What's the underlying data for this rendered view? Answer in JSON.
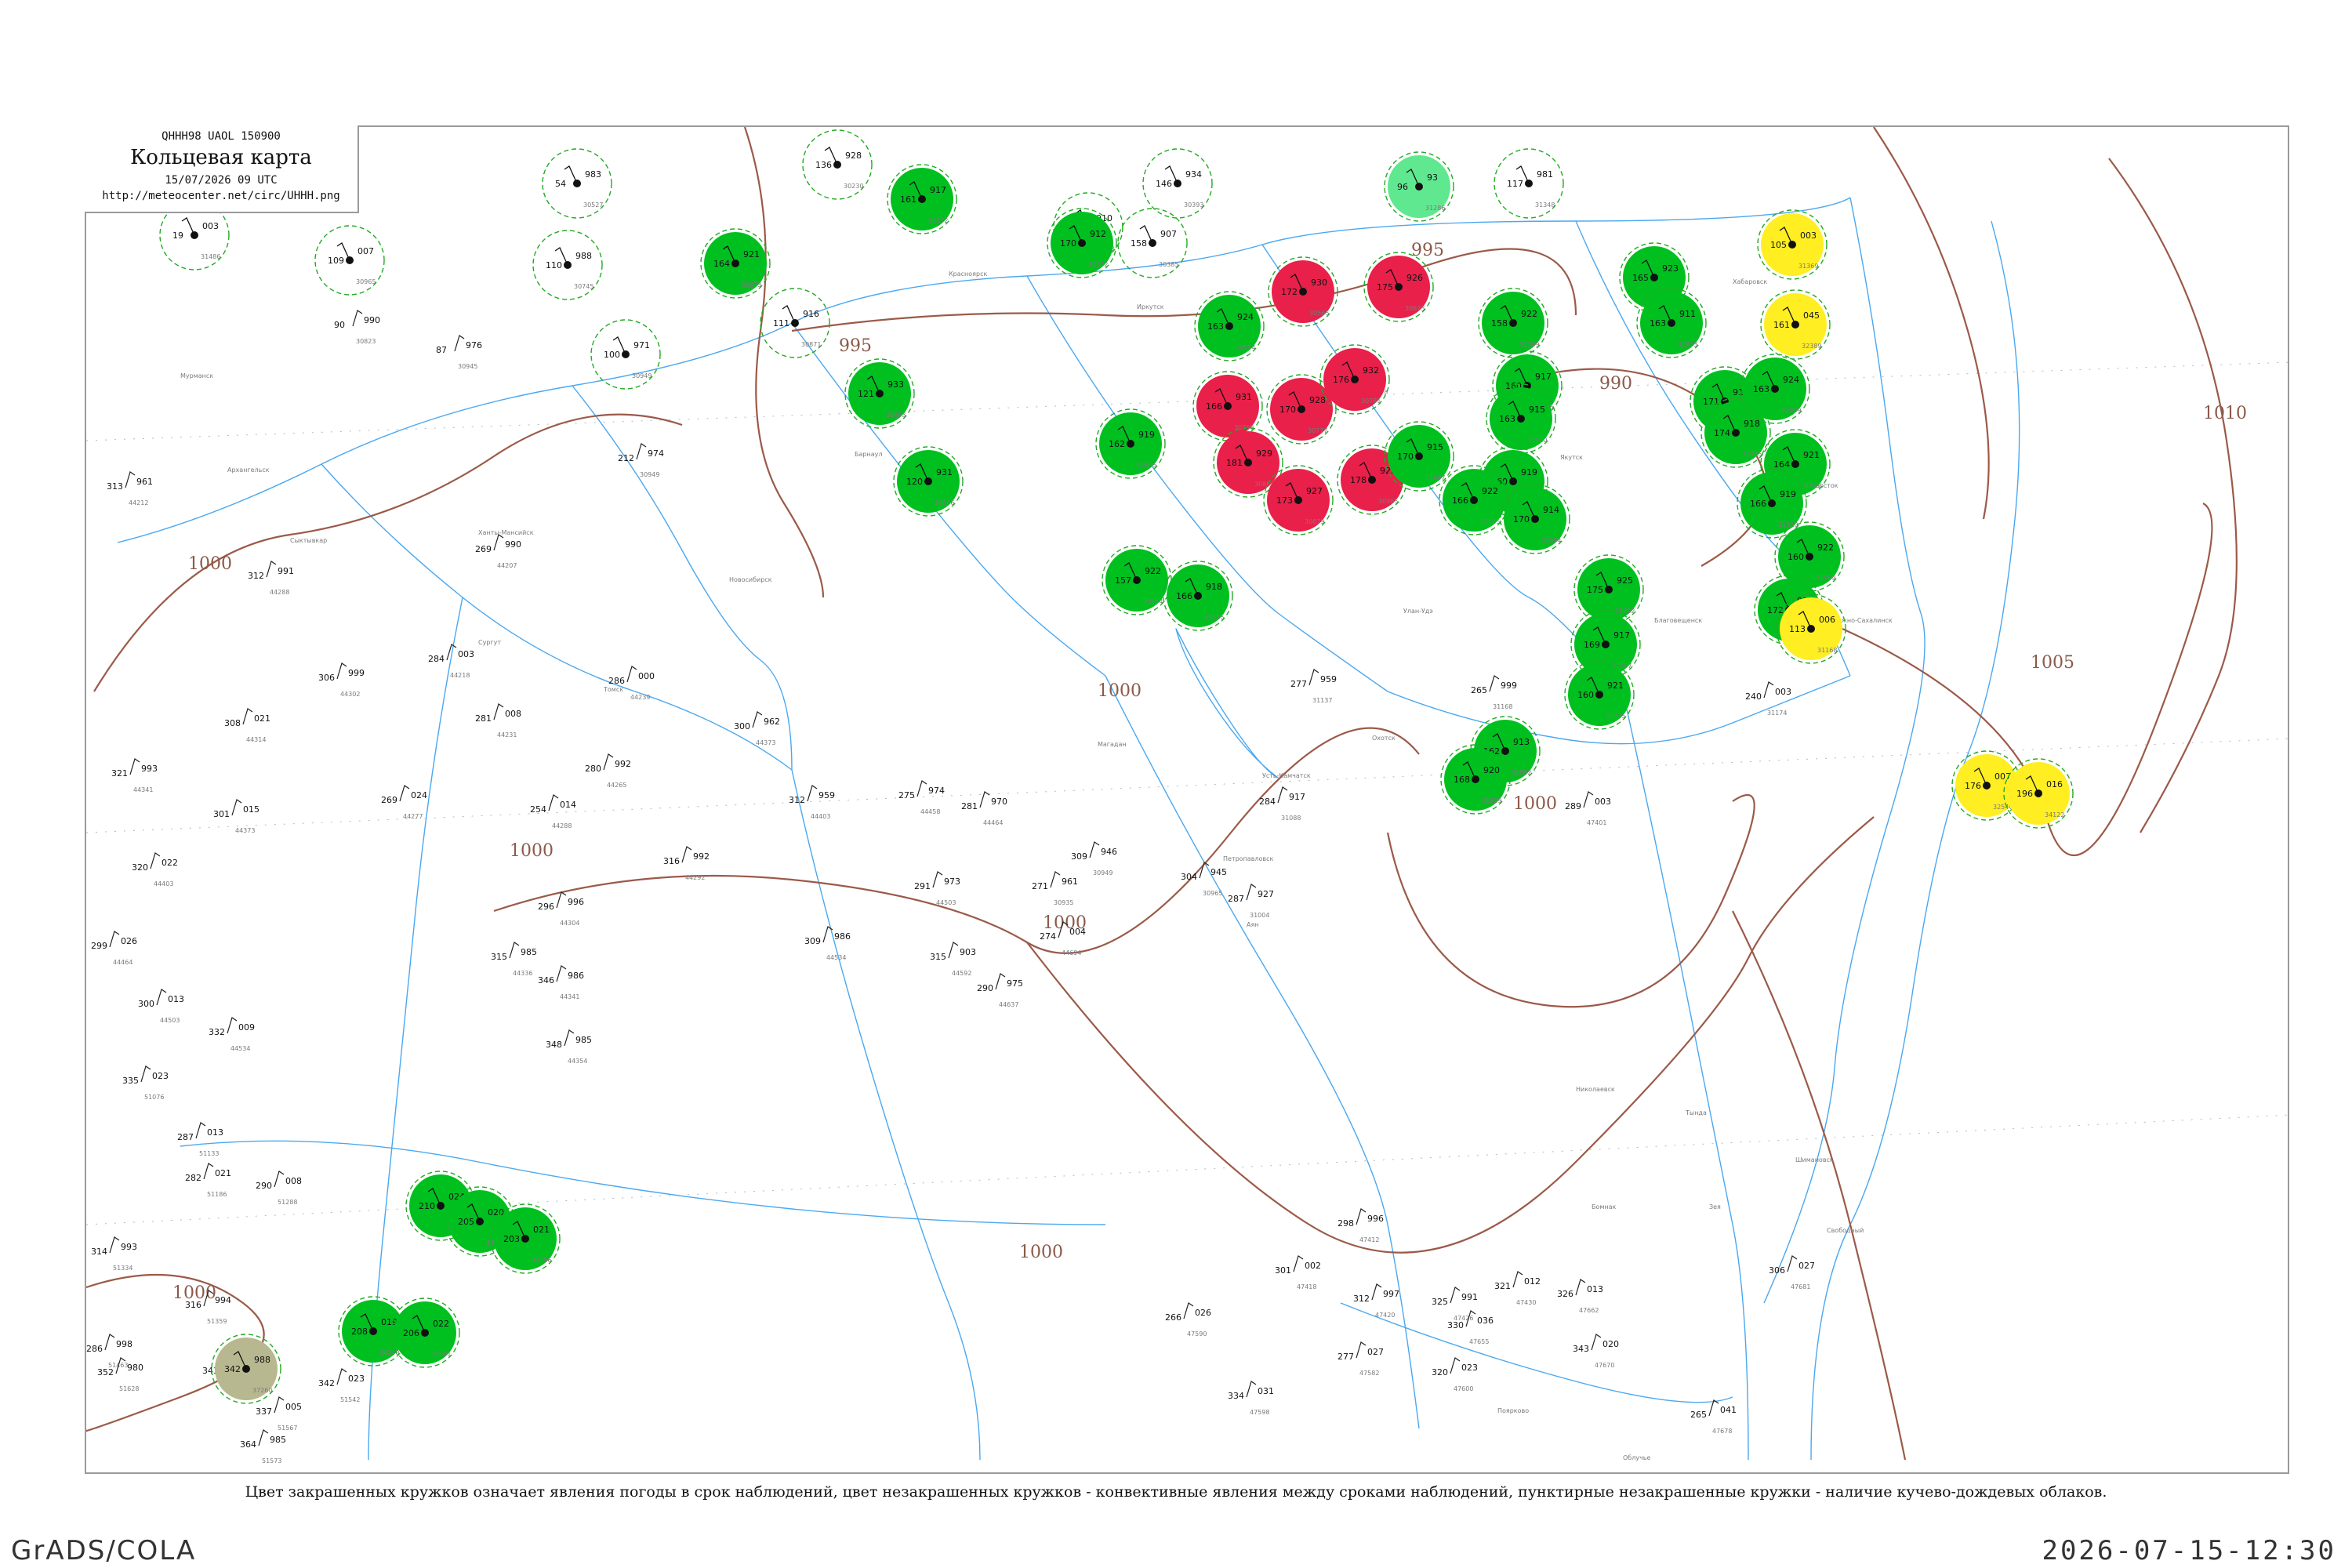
{
  "title_box": {
    "code": "QHHH98  UAOL  150900",
    "title": "Кольцевая карта",
    "date": "15/07/2026 09 UTC",
    "url": "http://meteocenter.net/circ/UHHH.png"
  },
  "caption": "Цвет закрашенных кружков означает явления погоды в срок наблюдений, цвет незакрашенных кружков - конвективные явления между сроками наблюдений, пунктирные незакрашенные кружки - наличие кучево-дождевых облаков.",
  "footer": {
    "left": "GrADS/COLA",
    "right": "2026-07-15-12:30"
  },
  "colors": {
    "rain": "#00c020",
    "thunder": "#e8204a",
    "showers": "#ffee22",
    "haze": "#b8b890",
    "fog": "#60e890",
    "isobar": "#9b5a48",
    "water": "#4aa8f0",
    "dashed_ring": "#22aa22"
  },
  "isobar_labels": [
    {
      "text": "995"
    },
    {
      "text": "995"
    },
    {
      "text": "990"
    },
    {
      "text": "1000"
    },
    {
      "text": "1000"
    },
    {
      "text": "1000"
    },
    {
      "text": "1000"
    },
    {
      "text": "1000"
    },
    {
      "text": "1000"
    },
    {
      "text": "1000"
    },
    {
      "text": "1005"
    },
    {
      "text": "1010"
    },
    {
      "text": "1000"
    }
  ],
  "stations": [
    {
      "ring": "dashed",
      "fill": "none",
      "p": "003",
      "t": "19",
      "id": "31486"
    },
    {
      "ring": "dashed",
      "fill": "none",
      "p": "007",
      "t": "109",
      "id": "30965"
    },
    {
      "ring": "dashed",
      "fill": "none",
      "p": "983",
      "t": "54",
      "id": "30527"
    },
    {
      "ring": "dashed",
      "fill": "none",
      "p": "988",
      "t": "110",
      "id": "30745"
    },
    {
      "ring": "solid",
      "fill": "rain",
      "p": "921",
      "t": "164",
      "id": "30673"
    },
    {
      "ring": "dashed",
      "fill": "none",
      "p": "971",
      "t": "100",
      "id": "30949"
    },
    {
      "ring": "dashed",
      "fill": "none",
      "p": "916",
      "t": "111",
      "id": "30871"
    },
    {
      "ring": "solid",
      "fill": "rain",
      "p": "933",
      "t": "121",
      "id": "30853"
    },
    {
      "ring": "solid",
      "fill": "rain",
      "p": "931",
      "t": "120",
      "id": "30846"
    },
    {
      "ring": "dashed",
      "fill": "none",
      "p": "928",
      "t": "136",
      "id": "30230"
    },
    {
      "ring": "solid",
      "fill": "rain",
      "p": "917",
      "t": "161",
      "id": "30252"
    },
    {
      "ring": "dashed",
      "fill": "none",
      "p": "910",
      "t": "160",
      "id": "30358"
    },
    {
      "ring": "solid",
      "fill": "rain",
      "p": "912",
      "t": "170",
      "id": "30372"
    },
    {
      "ring": "dashed",
      "fill": "none",
      "p": "907",
      "t": "158",
      "id": "30385"
    },
    {
      "ring": "dashed",
      "fill": "none",
      "p": "934",
      "t": "146",
      "id": "30393"
    },
    {
      "ring": "solid",
      "fill": "rain",
      "p": "924",
      "t": "163",
      "id": "30554"
    },
    {
      "ring": "solid",
      "fill": "thunder",
      "p": "930",
      "t": "172",
      "id": "30565"
    },
    {
      "ring": "solid",
      "fill": "thunder",
      "p": "926",
      "t": "175",
      "id": "30673"
    },
    {
      "ring": "solid",
      "fill": "thunder",
      "p": "931",
      "t": "166",
      "id": "30758"
    },
    {
      "ring": "solid",
      "fill": "thunder",
      "p": "928",
      "t": "170",
      "id": "30777"
    },
    {
      "ring": "solid",
      "fill": "thunder",
      "p": "932",
      "t": "176",
      "id": "30781"
    },
    {
      "ring": "solid",
      "fill": "thunder",
      "p": "929",
      "t": "181",
      "id": "30862"
    },
    {
      "ring": "solid",
      "fill": "thunder",
      "p": "927",
      "t": "173",
      "id": "30879"
    },
    {
      "ring": "solid",
      "fill": "thunder",
      "p": "925",
      "t": "178",
      "id": "30965"
    },
    {
      "ring": "solid",
      "fill": "rain",
      "p": "919",
      "t": "162",
      "id": "30695"
    },
    {
      "ring": "solid",
      "fill": "rain",
      "p": "922",
      "t": "157",
      "id": "30554"
    },
    {
      "ring": "solid",
      "fill": "rain",
      "p": "918",
      "t": "166",
      "id": "30935"
    },
    {
      "ring": "solid",
      "fill": "rain",
      "p": "915",
      "t": "170",
      "id": "31007"
    },
    {
      "ring": "solid",
      "fill": "fog",
      "p": "93",
      "t": "96",
      "id": "31286"
    },
    {
      "ring": "dashed",
      "fill": "none",
      "p": "981",
      "t": "117",
      "id": "31348"
    },
    {
      "ring": "solid",
      "fill": "rain",
      "p": "922",
      "t": "158",
      "id": "31369"
    },
    {
      "ring": "solid",
      "fill": "rain",
      "p": "917",
      "t": "160",
      "id": "31416"
    },
    {
      "ring": "solid",
      "fill": "rain",
      "p": "915",
      "t": "163",
      "id": "31510"
    },
    {
      "ring": "solid",
      "fill": "rain",
      "p": "919",
      "t": "160",
      "id": "31532"
    },
    {
      "ring": "solid",
      "fill": "rain",
      "p": "922",
      "t": "166",
      "id": "31585"
    },
    {
      "ring": "solid",
      "fill": "rain",
      "p": "914",
      "t": "170",
      "id": "31594"
    },
    {
      "ring": "solid",
      "fill": "rain",
      "p": "925",
      "t": "175",
      "id": "31702"
    },
    {
      "ring": "solid",
      "fill": "rain",
      "p": "917",
      "t": "169",
      "id": "31707"
    },
    {
      "ring": "solid",
      "fill": "rain",
      "p": "921",
      "t": "160",
      "id": "31725"
    },
    {
      "ring": "solid",
      "fill": "rain",
      "p": "913",
      "t": "162",
      "id": "31802"
    },
    {
      "ring": "solid",
      "fill": "rain",
      "p": "920",
      "t": "168",
      "id": "31829"
    },
    {
      "ring": "solid",
      "fill": "rain",
      "p": "923",
      "t": "165",
      "id": "31833"
    },
    {
      "ring": "solid",
      "fill": "rain",
      "p": "911",
      "t": "163",
      "id": "31873"
    },
    {
      "ring": "solid",
      "fill": "rain",
      "p": "916",
      "t": "171",
      "id": "31909"
    },
    {
      "ring": "solid",
      "fill": "rain",
      "p": "918",
      "t": "174",
      "id": "31915"
    },
    {
      "ring": "solid",
      "fill": "rain",
      "p": "924",
      "t": "163",
      "id": "31939"
    },
    {
      "ring": "solid",
      "fill": "rain",
      "p": "921",
      "t": "164",
      "id": "31942"
    },
    {
      "ring": "solid",
      "fill": "rain",
      "p": "919",
      "t": "166",
      "id": "31950"
    },
    {
      "ring": "solid",
      "fill": "rain",
      "p": "922",
      "t": "160",
      "id": "31959"
    },
    {
      "ring": "solid",
      "fill": "rain",
      "p": "917",
      "t": "172",
      "id": "31960"
    },
    {
      "ring": "solid",
      "fill": "showers",
      "p": "006",
      "t": "113",
      "id": "31168"
    },
    {
      "ring": "solid",
      "fill": "showers",
      "p": "003",
      "t": "105",
      "id": "31369"
    },
    {
      "ring": "solid",
      "fill": "showers",
      "p": "045",
      "t": "161",
      "id": "32389"
    },
    {
      "ring": "solid",
      "fill": "showers",
      "p": "007",
      "t": "176",
      "id": "32540"
    },
    {
      "ring": "solid",
      "fill": "showers",
      "p": "016",
      "t": "196",
      "id": "34122"
    },
    {
      "ring": "solid",
      "fill": "rain",
      "p": "024",
      "t": "210",
      "id": "34139"
    },
    {
      "ring": "solid",
      "fill": "rain",
      "p": "020",
      "t": "205",
      "id": "34152"
    },
    {
      "ring": "solid",
      "fill": "rain",
      "p": "021",
      "t": "203",
      "id": "34186"
    },
    {
      "ring": "solid",
      "fill": "rain",
      "p": "019",
      "t": "208",
      "id": "34240"
    },
    {
      "ring": "solid",
      "fill": "rain",
      "p": "022",
      "t": "206",
      "id": "34391"
    },
    {
      "ring": "solid",
      "fill": "haze",
      "p": "988",
      "t": "342",
      "id": "37260"
    }
  ],
  "plain_stations": [
    {
      "p": "990",
      "t": "90",
      "id": "30823"
    },
    {
      "p": "976",
      "t": "87",
      "id": "30945"
    },
    {
      "p": "974",
      "t": "212",
      "id": "30949"
    },
    {
      "p": "961",
      "t": "313",
      "id": "44212"
    },
    {
      "p": "991",
      "t": "312",
      "id": "44288"
    },
    {
      "p": "999",
      "t": "306",
      "id": "44302"
    },
    {
      "p": "021",
      "t": "308",
      "id": "44314"
    },
    {
      "p": "993",
      "t": "321",
      "id": "44341"
    },
    {
      "p": "015",
      "t": "301",
      "id": "44373"
    },
    {
      "p": "022",
      "t": "320",
      "id": "44403"
    },
    {
      "p": "026",
      "t": "299",
      "id": "44464"
    },
    {
      "p": "013",
      "t": "300",
      "id": "44503"
    },
    {
      "p": "009",
      "t": "332",
      "id": "44534"
    },
    {
      "p": "023",
      "t": "335",
      "id": "51076"
    },
    {
      "p": "013",
      "t": "287",
      "id": "51133"
    },
    {
      "p": "021",
      "t": "282",
      "id": "51186"
    },
    {
      "p": "008",
      "t": "290",
      "id": "51288"
    },
    {
      "p": "993",
      "t": "314",
      "id": "51334"
    },
    {
      "p": "994",
      "t": "316",
      "id": "51359"
    },
    {
      "p": "991",
      "t": "343",
      "id": "51433"
    },
    {
      "p": "998",
      "t": "286",
      "id": "51463"
    },
    {
      "p": "023",
      "t": "342",
      "id": "51542"
    },
    {
      "p": "005",
      "t": "337",
      "id": "51567"
    },
    {
      "p": "985",
      "t": "364",
      "id": "51573"
    },
    {
      "p": "980",
      "t": "352",
      "id": "51628"
    },
    {
      "p": "990",
      "t": "269",
      "id": "44207"
    },
    {
      "p": "003",
      "t": "284",
      "id": "44218"
    },
    {
      "p": "008",
      "t": "281",
      "id": "44231"
    },
    {
      "p": "000",
      "t": "286",
      "id": "44239"
    },
    {
      "p": "992",
      "t": "280",
      "id": "44265"
    },
    {
      "p": "024",
      "t": "269",
      "id": "44277"
    },
    {
      "p": "014",
      "t": "254",
      "id": "44288"
    },
    {
      "p": "992",
      "t": "316",
      "id": "44292"
    },
    {
      "p": "996",
      "t": "296",
      "id": "44304"
    },
    {
      "p": "985",
      "t": "315",
      "id": "44336"
    },
    {
      "p": "986",
      "t": "346",
      "id": "44341"
    },
    {
      "p": "985",
      "t": "348",
      "id": "44354"
    },
    {
      "p": "962",
      "t": "300",
      "id": "44373"
    },
    {
      "p": "959",
      "t": "312",
      "id": "44403"
    },
    {
      "p": "974",
      "t": "275",
      "id": "44458"
    },
    {
      "p": "970",
      "t": "281",
      "id": "44464"
    },
    {
      "p": "973",
      "t": "291",
      "id": "44503"
    },
    {
      "p": "986",
      "t": "309",
      "id": "44534"
    },
    {
      "p": "903",
      "t": "315",
      "id": "44592"
    },
    {
      "p": "975",
      "t": "290",
      "id": "44637"
    },
    {
      "p": "004",
      "t": "274",
      "id": "44694"
    },
    {
      "p": "961",
      "t": "271",
      "id": "30935"
    },
    {
      "p": "946",
      "t": "309",
      "id": "30949"
    },
    {
      "p": "945",
      "t": "304",
      "id": "30965"
    },
    {
      "p": "927",
      "t": "287",
      "id": "31004"
    },
    {
      "p": "917",
      "t": "284",
      "id": "31088"
    },
    {
      "p": "959",
      "t": "277",
      "id": "31137"
    },
    {
      "p": "999",
      "t": "265",
      "id": "31168"
    },
    {
      "p": "003",
      "t": "240",
      "id": "31174"
    },
    {
      "p": "003",
      "t": "289",
      "id": "47401"
    },
    {
      "p": "996",
      "t": "298",
      "id": "47412"
    },
    {
      "p": "002",
      "t": "301",
      "id": "47418"
    },
    {
      "p": "997",
      "t": "312",
      "id": "47420"
    },
    {
      "p": "991",
      "t": "325",
      "id": "47426"
    },
    {
      "p": "012",
      "t": "321",
      "id": "47430"
    },
    {
      "p": "027",
      "t": "277",
      "id": "47582"
    },
    {
      "p": "026",
      "t": "266",
      "id": "47590"
    },
    {
      "p": "031",
      "t": "334",
      "id": "47598"
    },
    {
      "p": "023",
      "t": "320",
      "id": "47600"
    },
    {
      "p": "036",
      "t": "330",
      "id": "47655"
    },
    {
      "p": "013",
      "t": "326",
      "id": "47662"
    },
    {
      "p": "020",
      "t": "343",
      "id": "47670"
    },
    {
      "p": "041",
      "t": "265",
      "id": "47678"
    },
    {
      "p": "027",
      "t": "306",
      "id": "47681"
    }
  ],
  "place_labels": [
    "Мурманск",
    "Архангельск",
    "Сыктывкар",
    "Ханты-Мансийск",
    "Сургут",
    "Томск",
    "Новосибирск",
    "Барнаул",
    "Красноярск",
    "Иркутск",
    "Чита",
    "Улан-Удэ",
    "Якутск",
    "Благовещенск",
    "Хабаровск",
    "Владивосток",
    "Южно-Сахалинск",
    "Магадан",
    "Петропавловск",
    "Усть-Камчатск",
    "Охотск",
    "Аян",
    "Николаевск",
    "Тында",
    "Зея",
    "Бомнак",
    "Шимановск",
    "Свободный",
    "Поярково",
    "Облучье"
  ]
}
